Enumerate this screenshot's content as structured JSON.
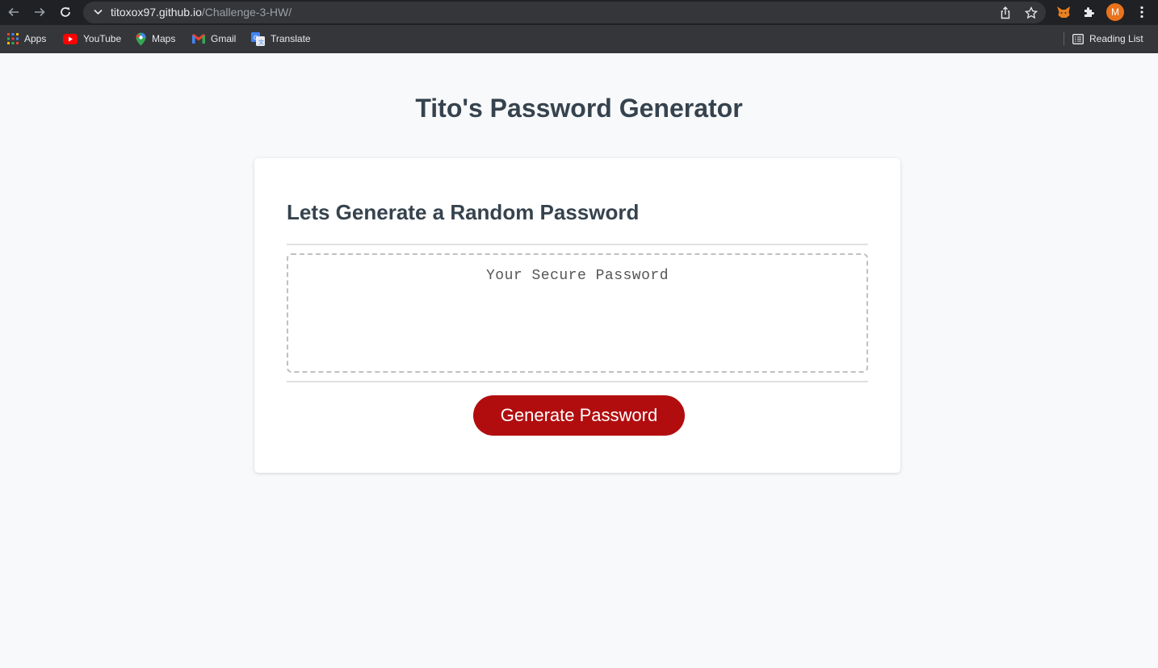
{
  "browser": {
    "url_host": "titoxox97.github.io",
    "url_path": "/Challenge-3-HW/",
    "profile_initial": "M",
    "bookmarks": [
      {
        "label": "Apps",
        "icon": "apps-grid-icon"
      },
      {
        "label": "YouTube",
        "icon": "youtube-icon"
      },
      {
        "label": "Maps",
        "icon": "maps-icon"
      },
      {
        "label": "Gmail",
        "icon": "gmail-icon"
      },
      {
        "label": "Translate",
        "icon": "translate-icon"
      }
    ],
    "reading_list_label": "Reading List"
  },
  "page": {
    "title": "Tito's Password Generator",
    "card_heading": "Lets Generate a Random Password",
    "password_placeholder": "Your Secure Password",
    "generate_button_label": "Generate Password"
  },
  "colors": {
    "heading": "#36434e",
    "button": "#b10d0f",
    "background": "#f8f9fb"
  }
}
